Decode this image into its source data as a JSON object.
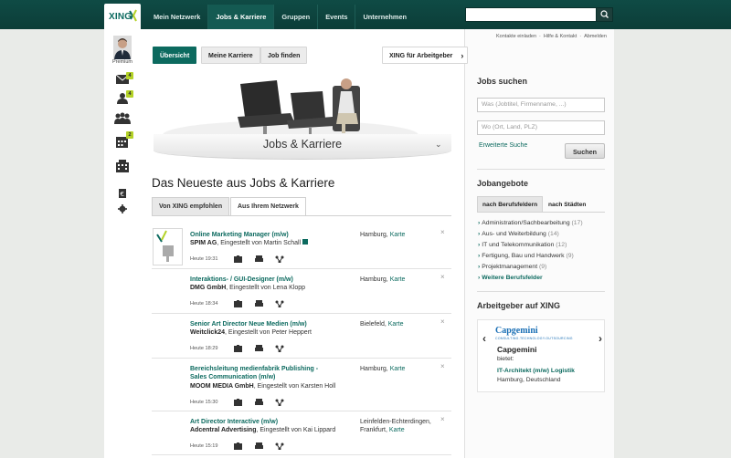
{
  "logo": {
    "text": "XING"
  },
  "nav": [
    "Mein Netzwerk",
    "Jobs & Karriere",
    "Gruppen",
    "Events",
    "Unternehmen"
  ],
  "search": {
    "placeholder": ""
  },
  "utility_links": [
    "Kontakte einladen",
    "Hilfe & Kontakt",
    "Abmelden"
  ],
  "sidebar": {
    "premium_label": "Premium",
    "badges": {
      "messages": "4",
      "contacts": "4",
      "calendar": "2"
    }
  },
  "tabs": [
    "Übersicht",
    "Meine Karriere",
    "Job finden",
    "XING für Arbeitgeber"
  ],
  "hero_title": "Jobs & Karriere",
  "section_title": "Das Neueste aus Jobs & Karriere",
  "subtabs": [
    "Von XING empfohlen",
    "Aus Ihrem Netzwerk"
  ],
  "jobs": [
    {
      "title": "Online Marketing Manager (m/w)",
      "company": "SPIM AG",
      "posted_by": ", Eingestellt von Martin Schall",
      "location": "Hamburg, ",
      "map": "Karte",
      "time": "Heute 19:31"
    },
    {
      "title": "Interaktions- / GUI-Designer (m/w)",
      "company": "DMG GmbH",
      "posted_by": ", Eingestellt von Lena Klopp",
      "location": "Hamburg, ",
      "map": "Karte",
      "time": "Heute 18:34"
    },
    {
      "title": "Senior Art Director Neue Medien (m/w)",
      "company": "Weitclick24",
      "posted_by": ", Eingestellt von Peter Heppert",
      "location": "Bielefeld, ",
      "map": "Karte",
      "time": "Heute 18:29"
    },
    {
      "title": "Bereichsleitung medienfabrik Publishing - Sales Communication (m/w)",
      "company": "MOOM MEDIA GmbH",
      "posted_by": ", Eingestellt von Karsten Holl",
      "location": "Hamburg, ",
      "map": "Karte",
      "time": "Heute 15:30"
    },
    {
      "title": "Art Director Interactive (m/w)",
      "company": "Adcentral Advertising",
      "posted_by": ", Eingestellt von Kai Lippard",
      "location": "Leinfelden-Echterdingen, Frankfurt, ",
      "map": "Karte",
      "time": "Heute 15:19"
    }
  ],
  "right": {
    "jobs_search_title": "Jobs suchen",
    "what_placeholder": "Was (Jobtitel, Firmenname, ...)",
    "where_placeholder": "Wo (Ort, Land, PLZ)",
    "advanced_search": "Erweiterte Suche",
    "search_button": "Suchen",
    "offers_title": "Jobangebote",
    "offer_tabs": [
      "nach Berufsfeldern",
      "nach Städten"
    ],
    "categories": [
      {
        "name": "Administration/Sachbearbeitung",
        "count": "(17)"
      },
      {
        "name": "Aus- und Weiterbildung",
        "count": "(14)"
      },
      {
        "name": "IT und Telekommunikation",
        "count": "(12)"
      },
      {
        "name": "Fertigung, Bau und Handwerk",
        "count": "(9)"
      },
      {
        "name": "Projektmanagement",
        "count": "(9)"
      }
    ],
    "more_categories": "Weitere Berufsfelder",
    "employers_title": "Arbeitgeber auf XING",
    "employer": {
      "logo_text": "Capgemini",
      "logo_sub": "CONSULTING.TECHNOLOGY.OUTSOURCING",
      "name": "Capgemini",
      "offers": "bietet:",
      "job": "IT-Architekt (m/w) Logistik",
      "location": "Hamburg, Deutschland"
    }
  },
  "colors": {
    "brand": "#0c6a5f",
    "topbar": "#0f4b45",
    "badge": "#b4d227"
  }
}
